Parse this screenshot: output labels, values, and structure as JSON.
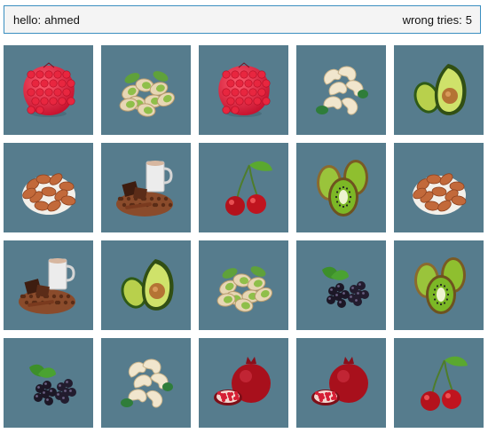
{
  "header": {
    "greeting_label": "hello:",
    "user_name": "ahmed",
    "wrong_label": "wrong tries:",
    "wrong_count": "5"
  },
  "cards": [
    {
      "fruit": "raspberry"
    },
    {
      "fruit": "pistachio"
    },
    {
      "fruit": "raspberry"
    },
    {
      "fruit": "cashew"
    },
    {
      "fruit": "avocado"
    },
    {
      "fruit": "almond"
    },
    {
      "fruit": "chocolate-drink"
    },
    {
      "fruit": "cherry"
    },
    {
      "fruit": "kiwi"
    },
    {
      "fruit": "almond"
    },
    {
      "fruit": "chocolate-drink"
    },
    {
      "fruit": "avocado"
    },
    {
      "fruit": "pistachio"
    },
    {
      "fruit": "blackberry"
    },
    {
      "fruit": "kiwi"
    },
    {
      "fruit": "blackberry"
    },
    {
      "fruit": "cashew"
    },
    {
      "fruit": "pomegranate"
    },
    {
      "fruit": "pomegranate"
    },
    {
      "fruit": "cherry"
    }
  ],
  "colors": {
    "card_bg": "#567c8d",
    "header_border": "#3b8fc0",
    "header_bg": "#f4f4f4"
  }
}
